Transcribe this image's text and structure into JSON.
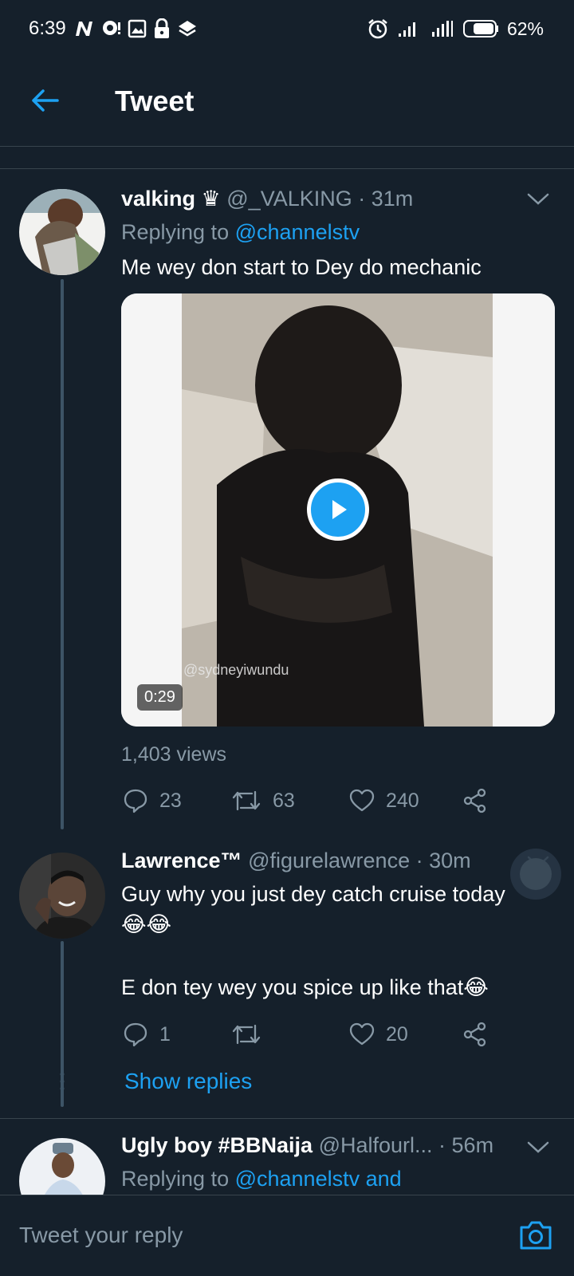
{
  "status_bar": {
    "time": "6:39",
    "battery": "62%"
  },
  "header": {
    "title": "Tweet"
  },
  "tweets": [
    {
      "name": "valking ♛",
      "handle": "@_VALKING",
      "time": "· 31m",
      "replying_prefix": "Replying to ",
      "replying_to": "@channelstv",
      "text": "Me wey don start to Dey do mechanic",
      "media": {
        "duration": "0:29",
        "watermark": "@sydneyiwundu"
      },
      "views": "1,403 views",
      "replies": "23",
      "retweets": "63",
      "likes": "240"
    },
    {
      "name": "Lawrence™",
      "handle": "@figurelawrence",
      "time": "· 30m",
      "text_line1": "Guy why you just dey catch cruise today",
      "text_line2": "😂😂",
      "text_line3": "E don tey wey you  spice up like that😂",
      "replies": "1",
      "retweets": "",
      "likes": "20",
      "show_replies": "Show replies"
    },
    {
      "name": "Ugly boy #BBNaija",
      "handle": "@Halfourl...",
      "time": "· 56m",
      "replying_prefix": "Replying to ",
      "replying_to": "@channelstv and"
    }
  ],
  "reply_bar": {
    "placeholder": "Tweet your reply"
  },
  "colors": {
    "background": "#15202b",
    "accent": "#1da1f2",
    "muted": "#8899a6",
    "divider": "#38444d"
  }
}
